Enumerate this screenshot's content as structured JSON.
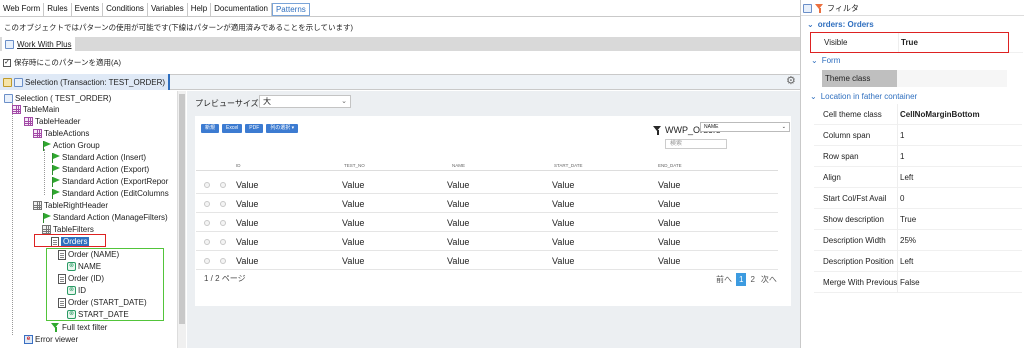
{
  "tabs": [
    "Web Form",
    "Rules",
    "Events",
    "Conditions",
    "Variables",
    "Help",
    "Documentation",
    "Patterns"
  ],
  "active_tab": "Patterns",
  "pattern_description": "このオブジェクトではパターンの使用が可能です(下線はパターンが適用済みであることを示しています)",
  "pattern_tab": "Work With Plus",
  "apply_on_save": "保存時にこのパターンを適用(A)",
  "selection_tab": "Selection (Transaction: TEST_ORDER)",
  "tree": {
    "root": "Selection ( TEST_ORDER)",
    "table_main": "TableMain",
    "table_header": "TableHeader",
    "table_actions": "TableActions",
    "action_group": "Action Group",
    "actions": [
      "Standard Action (Insert)",
      "Standard Action (Export)",
      "Standard Action (ExportRepor",
      "Standard Action (EditColumns"
    ],
    "table_right_header": "TableRightHeader",
    "manage_filters": "Standard Action (ManageFilters)",
    "table_filters": "TableFilters",
    "orders": "Orders",
    "order_name": "Order (NAME)",
    "name": "NAME",
    "order_id": "Order (ID)",
    "id": "ID",
    "order_start_date": "Order (START_DATE)",
    "start_date": "START_DATE",
    "full_text_filter": "Full text filter",
    "error_viewer": "Error viewer"
  },
  "preview": {
    "size_label": "プレビューサイズ",
    "size_value": "大",
    "mini_buttons": [
      "新規",
      "Excel",
      "PDF",
      "列の選択 ▾"
    ],
    "title": "WWP_Orders",
    "order_select": "NAME",
    "search_placeholder": "検索",
    "columns": [
      "ID",
      "TEST_NO",
      "NAME",
      "START_DATE",
      "END_DATE"
    ],
    "rows": [
      [
        "Value",
        "Value",
        "Value",
        "Value",
        "Value"
      ],
      [
        "Value",
        "Value",
        "Value",
        "Value",
        "Value"
      ],
      [
        "Value",
        "Value",
        "Value",
        "Value",
        "Value"
      ],
      [
        "Value",
        "Value",
        "Value",
        "Value",
        "Value"
      ],
      [
        "Value",
        "Value",
        "Value",
        "Value",
        "Value"
      ]
    ],
    "page_info": "1 / 2 ページ",
    "pager": {
      "prev": "前へ",
      "p1": "1",
      "p2": "2",
      "next": "次へ"
    }
  },
  "props": {
    "filter_label": "フィルタ",
    "object_title": "orders: Orders",
    "visible_key": "Visible",
    "visible_val": "True",
    "form_section": "Form",
    "theme_class_key": "Theme class",
    "location_section": "Location in father container",
    "rows": [
      {
        "k": "Cell theme class",
        "v": "CellNoMarginBottom"
      },
      {
        "k": "Column span",
        "v": "1"
      },
      {
        "k": "Row span",
        "v": "1"
      },
      {
        "k": "Align",
        "v": "Left"
      },
      {
        "k": "Start Col/Fst Avail",
        "v": "0"
      },
      {
        "k": "Show description",
        "v": "True"
      },
      {
        "k": "Description Width",
        "v": "25%"
      },
      {
        "k": "Description Position",
        "v": "Left"
      },
      {
        "k": "Merge With Previous",
        "v": "False"
      }
    ]
  },
  "colors": {
    "accent": "#2f6fbf",
    "highlight_red": "#dd2222",
    "highlight_green": "#52c43a",
    "page_blue": "#3c9be0"
  }
}
